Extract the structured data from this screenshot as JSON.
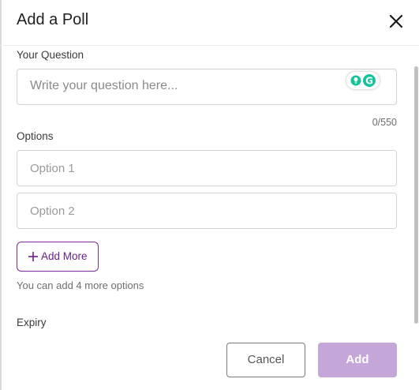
{
  "dialog": {
    "title": "Add a Poll",
    "close_icon": "close-icon"
  },
  "question": {
    "label": "Your Question",
    "placeholder": "Write your question here...",
    "value": "",
    "counter": "0/550",
    "extension_icon": "grammarly-icon"
  },
  "options": {
    "label": "Options",
    "items": [
      {
        "placeholder": "Option 1",
        "value": ""
      },
      {
        "placeholder": "Option 2",
        "value": ""
      }
    ],
    "add_more_label": "Add More",
    "add_more_icon": "plus-icon",
    "hint": "You can add 4 more options"
  },
  "expiry": {
    "label": "Expiry"
  },
  "footer": {
    "cancel_label": "Cancel",
    "add_label": "Add"
  },
  "colors": {
    "accent": "#7d2a9c",
    "add_button_disabled": "#c4a6d8",
    "grammarly_green": "#15c39a"
  }
}
